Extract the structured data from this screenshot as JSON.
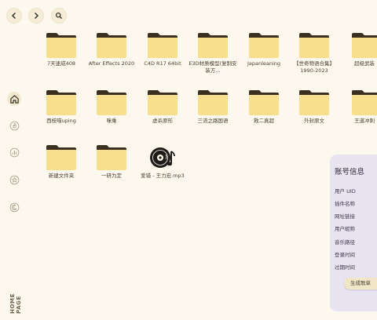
{
  "nav": {
    "back_icon": "chevron-left-icon",
    "forward_icon": "chevron-right-icon",
    "search_icon": "search-icon"
  },
  "rail": {
    "items": [
      {
        "icon": "home-icon"
      },
      {
        "icon": "fire-icon"
      },
      {
        "icon": "chart-icon"
      },
      {
        "icon": "star-icon"
      },
      {
        "icon": "moon-icon"
      }
    ],
    "label": "HOME PAGE"
  },
  "files": {
    "row1": [
      {
        "name": "7天速成408"
      },
      {
        "name": "After Effects 2020"
      },
      {
        "name": "C4D R17 64bit"
      },
      {
        "name": "E3D材质模型(复制安装方..."
      },
      {
        "name": "Japanleaning"
      },
      {
        "name": "【世奇物语合集】1990-2023"
      },
      {
        "name": "超级武装"
      }
    ],
    "row2": [
      {
        "name": "西枝喵uping"
      },
      {
        "name": "咪乘"
      },
      {
        "name": "虚杀原形"
      },
      {
        "name": "三流之路国语"
      },
      {
        "name": "救二真超"
      },
      {
        "name": "外封原文"
      },
      {
        "name": "王道冲刺"
      }
    ],
    "row3": [
      {
        "name": "新建文件夹"
      },
      {
        "name": "一研为定"
      },
      {
        "name": "爱错 - 王力宏.mp3",
        "type": "audio"
      }
    ]
  },
  "account": {
    "title": "账号信息",
    "rows": [
      "用户 UID",
      "插件名称",
      "网址链接",
      "用户昵称",
      "音乐路径",
      "登录时间",
      "过期时间"
    ],
    "button": "生成歌单"
  },
  "colors": {
    "folder": "#f8df8d",
    "folder_tab": "#3b2f22",
    "background": "#fcf8ee",
    "panel": "#e8e4f1"
  }
}
